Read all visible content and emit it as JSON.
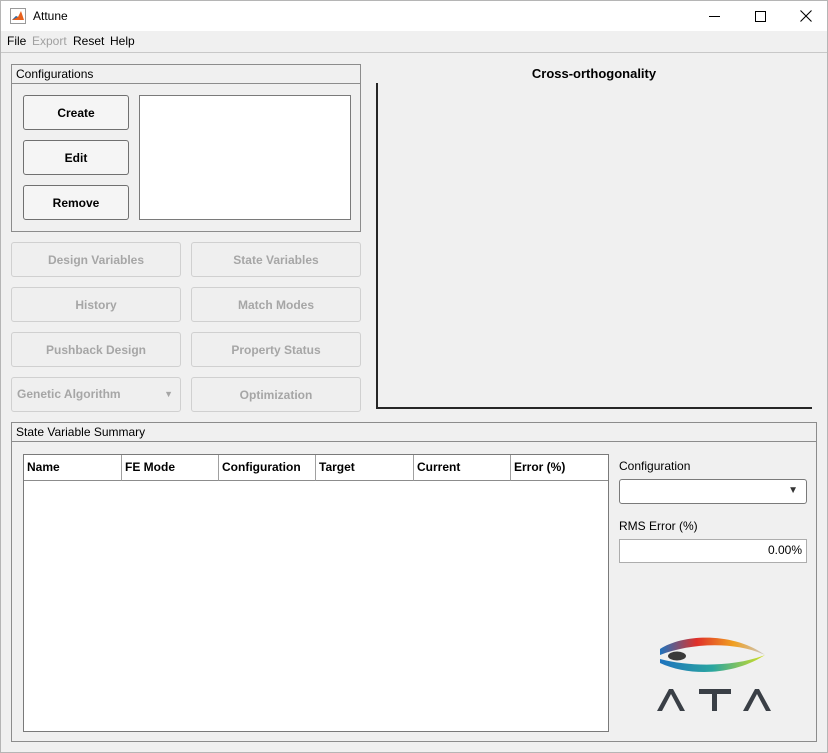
{
  "window": {
    "title": "Attune"
  },
  "menu": {
    "items": [
      {
        "label": "File",
        "enabled": true
      },
      {
        "label": "Export",
        "enabled": false
      },
      {
        "label": "Reset",
        "enabled": true
      },
      {
        "label": "Help",
        "enabled": true
      }
    ]
  },
  "configurations": {
    "title": "Configurations",
    "create_label": "Create",
    "edit_label": "Edit",
    "remove_label": "Remove"
  },
  "actions": {
    "design_variables": "Design Variables",
    "state_variables": "State Variables",
    "history": "History",
    "match_modes": "Match Modes",
    "pushback_design": "Pushback Design",
    "property_status": "Property Status",
    "algorithm_selected": "Genetic Algorithm",
    "optimization": "Optimization"
  },
  "plot": {
    "title": "Cross-orthogonality"
  },
  "summary": {
    "title": "State Variable Summary",
    "columns": [
      "Name",
      "FE Mode",
      "Configuration",
      "Target",
      "Current",
      "Error (%)"
    ],
    "configuration_label": "Configuration",
    "configuration_value": "",
    "rms_label": "RMS Error (%)",
    "rms_value": "0.00%"
  },
  "logo": {
    "text": "ATA",
    "colors": [
      "#1e73be",
      "#e0302a",
      "#f0a020",
      "#8cc63f"
    ]
  }
}
